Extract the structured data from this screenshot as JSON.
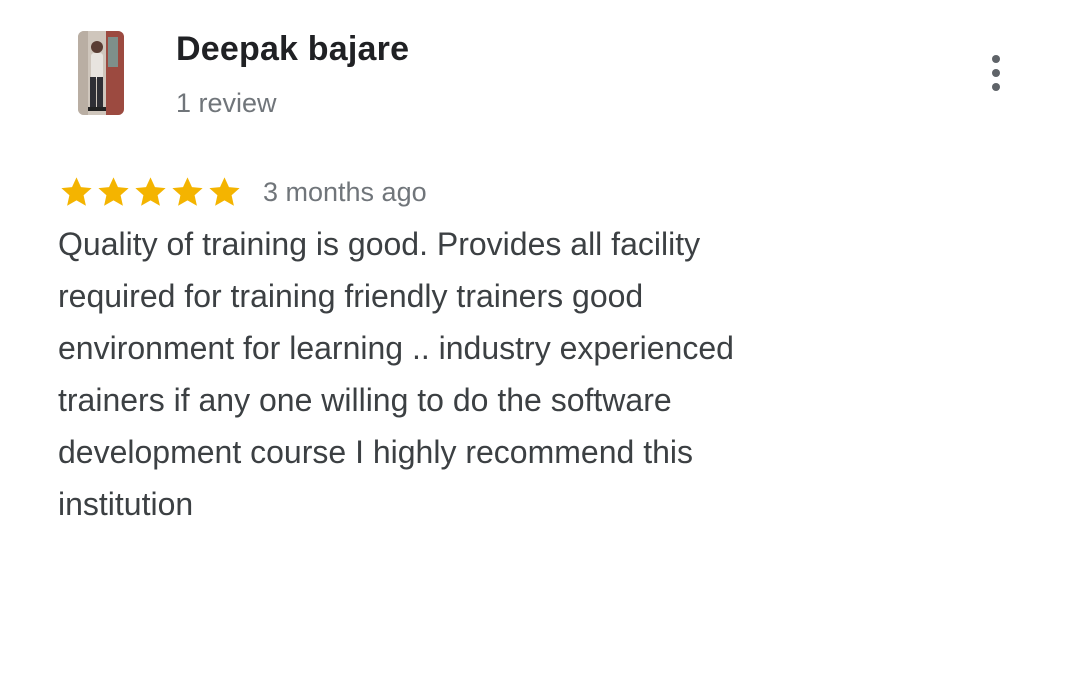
{
  "review": {
    "author": {
      "name": "Deepak bajare",
      "review_count": "1 review",
      "avatar_icon": "user-photo-avatar"
    },
    "menu_icon": "more-vert-icon",
    "rating": {
      "stars": 5,
      "max_stars": 5,
      "star_color": "#f4b400",
      "time_ago": "3 months ago"
    },
    "text_lines": [
      "Quality of training is good. Provides all facility",
      "required for training friendly trainers good",
      "environment for learning .. industry experienced",
      "trainers if any one willing to do the software",
      "development course I highly recommend this",
      "institution"
    ]
  }
}
